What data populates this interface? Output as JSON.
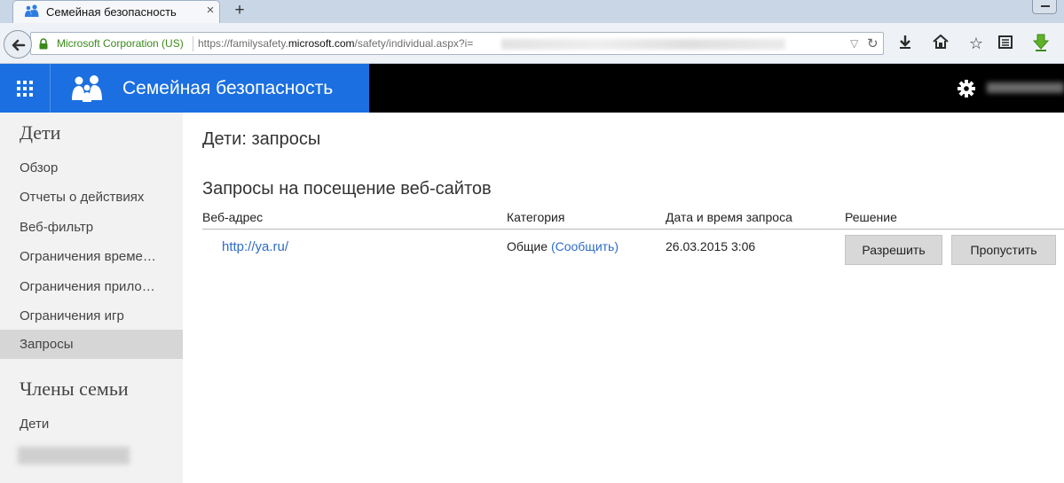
{
  "browser": {
    "tab_title": "Семейная безопасность",
    "tab_close": "×",
    "new_tab": "+",
    "identity": "Microsoft Corporation (US)",
    "url_prefix": "https://familysafety.",
    "url_domain": "microsoft.com",
    "url_suffix": "/safety/individual.aspx?i=",
    "toolbar_icons": [
      "download-icon",
      "home-icon",
      "star-icon",
      "reading-list-icon",
      "green-download-icon"
    ]
  },
  "header": {
    "title": "Семейная безопасность",
    "accent": "#1b6fe0"
  },
  "sidebar": {
    "section1": "Дети",
    "items": [
      {
        "label": "Обзор"
      },
      {
        "label": "Отчеты о действиях"
      },
      {
        "label": "Веб-фильтр"
      },
      {
        "label": "Ограничения време…"
      },
      {
        "label": "Ограничения прило…"
      },
      {
        "label": "Ограничения игр"
      },
      {
        "label": "Запросы"
      }
    ],
    "section2": "Члены семьи",
    "family_items": [
      {
        "label": "Дети"
      }
    ]
  },
  "main": {
    "page_title": "Дети: запросы",
    "section_title": "Запросы на посещение веб-сайтов",
    "columns": [
      "Веб-адрес",
      "Категория",
      "Дата и время запроса",
      "Решение"
    ],
    "rows": [
      {
        "url": "http://ya.ru/",
        "category": "Общие",
        "report_link": "(Сообщить)",
        "datetime": "26.03.2015 3:06",
        "allow_label": "Разрешить",
        "skip_label": "Пропустить"
      }
    ]
  }
}
